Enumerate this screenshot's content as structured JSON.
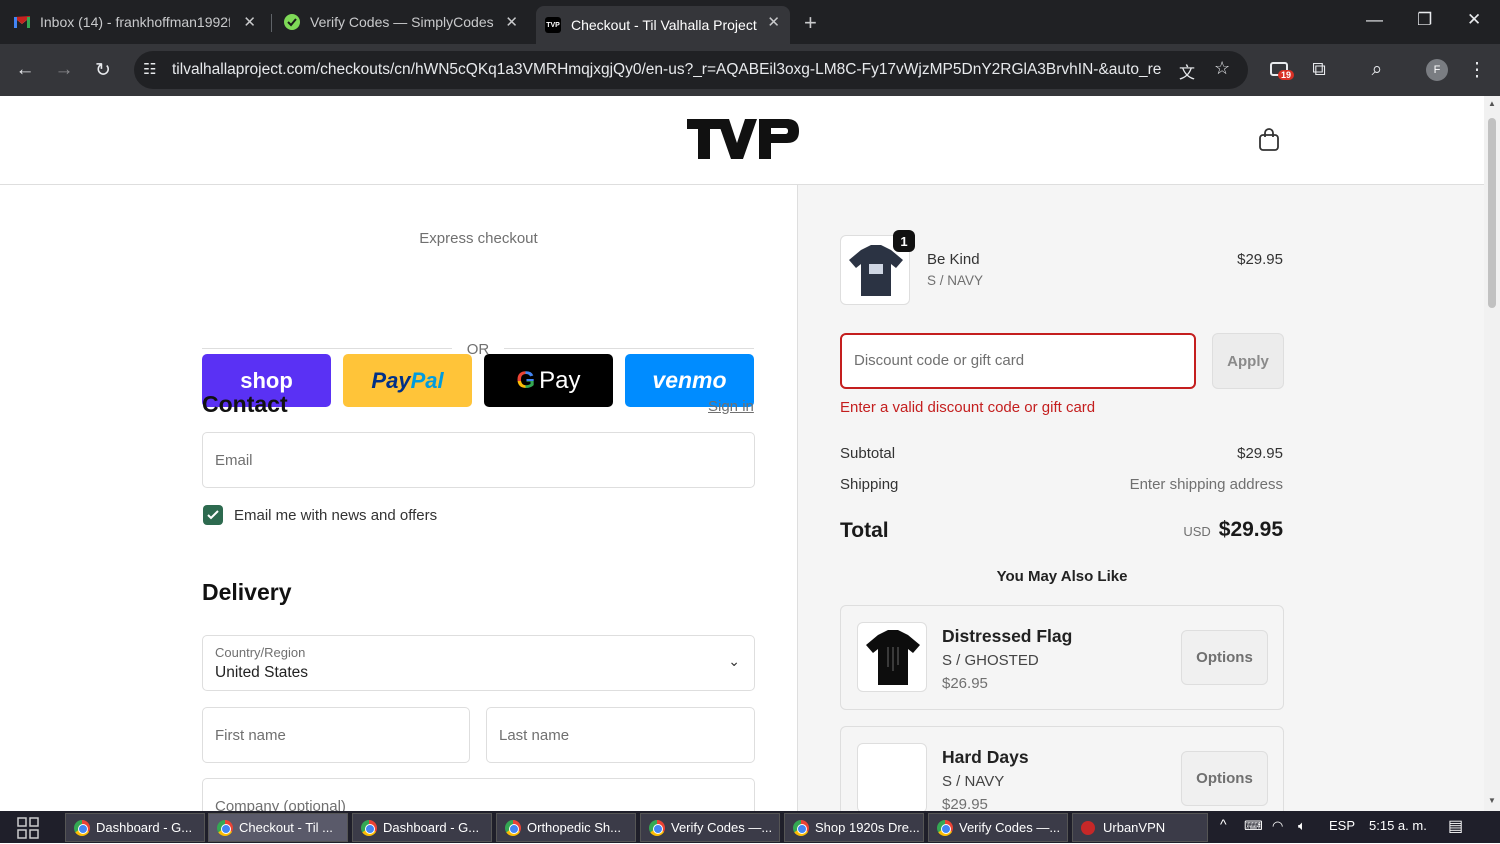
{
  "browser": {
    "tabs": [
      {
        "title": "Inbox (14) - frankhoffman1992f",
        "icon": "gmail-icon"
      },
      {
        "title": "Verify Codes — SimplyCodes",
        "icon": "simplycodes-icon"
      },
      {
        "title": "Checkout - Til Valhalla Project",
        "icon": "tvp-icon",
        "active": true
      }
    ],
    "url": "tilvalhallaproject.com/checkouts/cn/hWN5cQKq1a3VMRHmqjxgjQy0/en-us?_r=AQABEil3oxg-LM8C-Fy17vWjzMP5DnY2RGlA3BrvhIN-&auto_redi...",
    "extension_badge": "19",
    "profile_initial": "F"
  },
  "header": {
    "logo_text": "TVP"
  },
  "express": {
    "label": "Express checkout",
    "shop": "shop",
    "paypal_pay": "Pay",
    "paypal_pal": "Pal",
    "gpay": "Pay",
    "venmo": "venmo",
    "or": "OR"
  },
  "contact": {
    "title": "Contact",
    "signin": "Sign in",
    "email_placeholder": "Email",
    "newsletter_label": "Email me with news and offers",
    "newsletter_checked": true
  },
  "delivery": {
    "title": "Delivery",
    "country_label": "Country/Region",
    "country_value": "United States",
    "first_name": "First name",
    "last_name": "Last name",
    "company": "Company (optional)"
  },
  "summary": {
    "item": {
      "name": "Be Kind",
      "variant": "S / NAVY",
      "price": "$29.95",
      "qty": "1"
    },
    "discount_placeholder": "Discount code or gift card",
    "apply": "Apply",
    "error": "Enter a valid discount code or gift card",
    "subtotal_label": "Subtotal",
    "subtotal_value": "$29.95",
    "shipping_label": "Shipping",
    "shipping_value": "Enter shipping address",
    "total_label": "Total",
    "currency": "USD",
    "total_value": "$29.95"
  },
  "upsell": {
    "title": "You May Also Like",
    "items": [
      {
        "name": "Distressed Flag",
        "variant": "S / GHOSTED",
        "price": "$26.95",
        "button": "Options"
      },
      {
        "name": "Hard Days",
        "variant": "S / NAVY",
        "price": "$29.95",
        "button": "Options"
      }
    ]
  },
  "taskbar": {
    "items": [
      "Dashboard - G...",
      "Checkout - Til ...",
      "Dashboard - G...",
      "Orthopedic Sh...",
      "Verify Codes —...",
      "Shop 1920s Dre...",
      "Verify Codes —...",
      "UrbanVPN"
    ],
    "lang": "ESP",
    "time": "5:15 a. m."
  },
  "colors": {
    "error": "#c41e1e",
    "accent": "#5a31f4",
    "link": "#707070"
  }
}
